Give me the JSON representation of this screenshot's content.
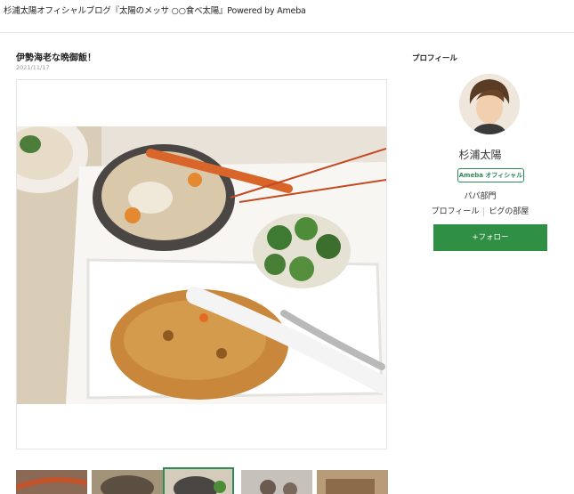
{
  "header": {
    "site_title": "杉浦太陽オフィシャルブログ『太陽のメッサ ○○食べ太陽』Powered by Ameba"
  },
  "entry": {
    "title": "伊勢海老な晩御飯！",
    "date": "2021/11/17",
    "photo_icon": "dinner-photo",
    "thumbnails": [
      "lobster-thumb",
      "soup-thumb",
      "tray-thumb",
      "kids-thumb",
      "box-thumb"
    ]
  },
  "sidebar": {
    "section_title": "プロフィール",
    "author_name": "杉浦太陽",
    "official_badge": "Ameba オフィシャル",
    "category": "パパ部門",
    "link_profile": "プロフィール",
    "link_room": "ピグの部屋",
    "follow_label": "+フォロー"
  },
  "colors": {
    "accent": "#2f8f45",
    "badge": "#2e8b57"
  }
}
